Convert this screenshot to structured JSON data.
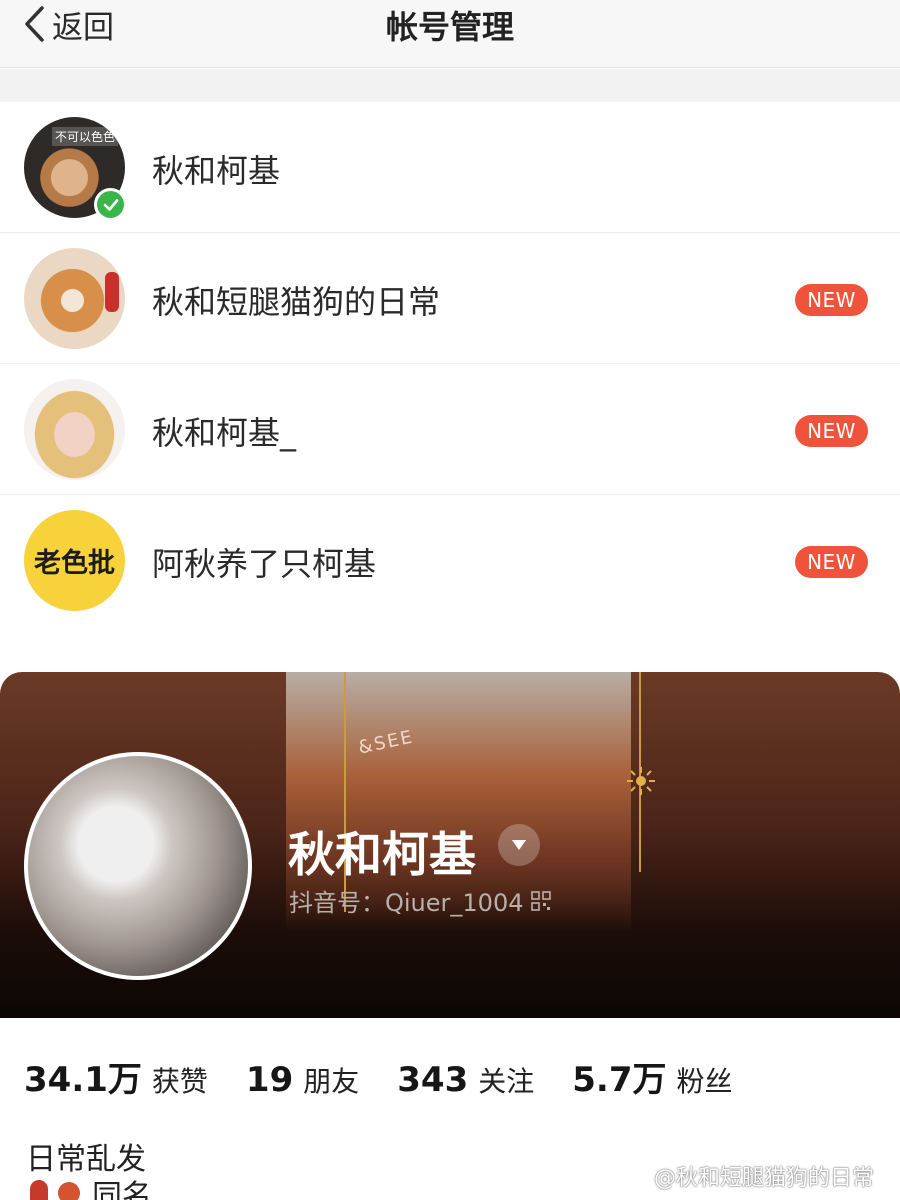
{
  "header": {
    "back_label": "返回",
    "title": "帐号管理"
  },
  "accounts": [
    {
      "name": "秋和柯基",
      "avatar_label": "不可以色色",
      "verified": true
    },
    {
      "name": "秋和短腿猫狗的日常",
      "badge": "NEW"
    },
    {
      "name": "秋和柯基_",
      "badge": "NEW"
    },
    {
      "name": "阿秋养了只柯基",
      "avatar_label": "老色批",
      "badge": "NEW"
    }
  ],
  "profile": {
    "cover_text": "&SEE",
    "name": "秋和柯基",
    "id_text": "抖音号：Qiuer_1004",
    "stats": [
      {
        "value": "34.1万",
        "label": "获赞"
      },
      {
        "value": "19",
        "label": "朋友"
      },
      {
        "value": "343",
        "label": "关注"
      },
      {
        "value": "5.7万",
        "label": "粉丝"
      }
    ],
    "bio_line1": "日常乱发",
    "bio_line2": "同名"
  },
  "watermark": "@秋和短腿猫狗的日常",
  "colors": {
    "badge": "#f0533b",
    "verified": "#3ab54a",
    "header_bg": "#f7f7f7",
    "avatar_yellow": "#f8d23a"
  }
}
